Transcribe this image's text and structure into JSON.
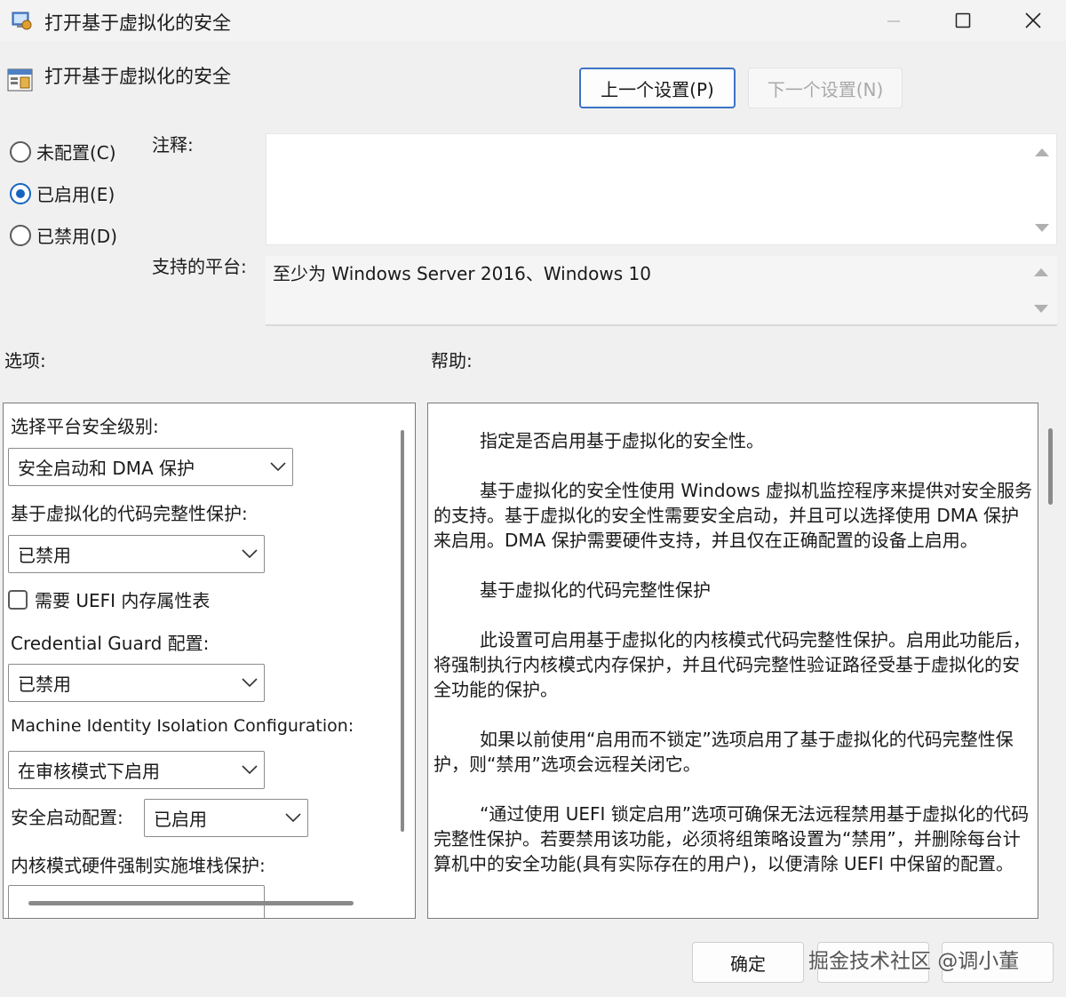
{
  "window": {
    "title": "打开基于虚拟化的安全"
  },
  "header": {
    "policy_title": "打开基于虚拟化的安全",
    "prev_button": "上一个设置(P)",
    "next_button": "下一个设置(N)"
  },
  "state": {
    "not_configured": "未配置(C)",
    "enabled": "已启用(E)",
    "disabled": "已禁用(D)",
    "selected": "enabled"
  },
  "comment": {
    "label": "注释:",
    "value": ""
  },
  "platform": {
    "label": "支持的平台:",
    "value": "至少为 Windows Server 2016、Windows 10"
  },
  "options": {
    "heading": "选项:",
    "platform_level_label": "选择平台安全级别:",
    "platform_level_value": "安全启动和 DMA 保护",
    "hvci_label": "基于虚拟化的代码完整性保护:",
    "hvci_value": "已禁用",
    "uefi_checkbox_label": "需要 UEFI 内存属性表",
    "credential_guard_label": "Credential Guard 配置:",
    "credential_guard_value": "已禁用",
    "machine_identity_label": "Machine Identity Isolation Configuration:",
    "machine_identity_value": "在审核模式下启用",
    "secure_launch_label": "安全启动配置:",
    "secure_launch_value": "已启用",
    "kernel_stack_label": "内核模式硬件强制实施堆栈保护:"
  },
  "help": {
    "heading": "帮助:",
    "paragraphs": [
      "指定是否启用基于虚拟化的安全性。",
      "基于虚拟化的安全性使用 Windows 虚拟机监控程序来提供对安全服务的支持。基于虚拟化的安全性需要安全启动，并且可以选择使用 DMA 保护来启用。DMA 保护需要硬件支持，并且仅在正确配置的设备上启用。",
      "基于虚拟化的代码完整性保护",
      "此设置可启用基于虚拟化的内核模式代码完整性保护。启用此功能后，将强制执行内核模式内存保护，并且代码完整性验证路径受基于虚拟化的安全功能的保护。",
      "如果以前使用“启用而不锁定”选项启用了基于虚拟化的代码完整性保护，则“禁用”选项会远程关闭它。",
      "“通过使用 UEFI 锁定启用”选项可确保无法远程禁用基于虚拟化的代码完整性保护。若要禁用该功能，必须将组策略设置为“禁用”，并删除每台计算机中的安全功能(具有实际存在的用户)，以便清除 UEFI 中保留的配置。"
    ]
  },
  "footer": {
    "ok_button": "确定",
    "watermark": "掘金技术社区 @调小董"
  },
  "colors": {
    "accent": "#1565c0",
    "dialog_bg": "#f0f0f0"
  }
}
